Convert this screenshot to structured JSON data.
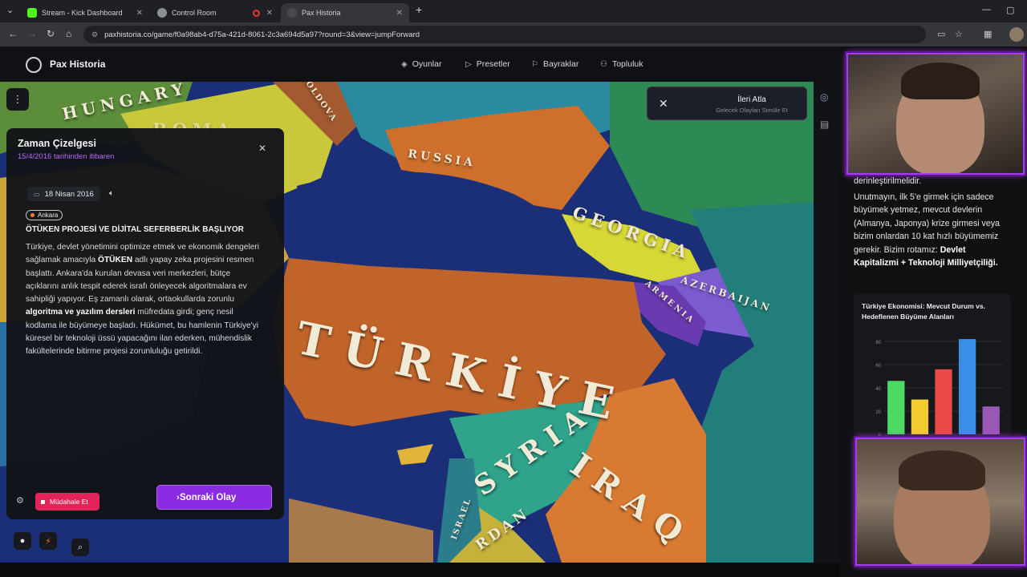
{
  "browser": {
    "tabs": [
      {
        "label": "Stream - Kick Dashboard",
        "icon": "kick-icon",
        "color": "#53fc18"
      },
      {
        "label": "Control Room",
        "icon": "globe-icon",
        "color": "#9aa0a6"
      },
      {
        "label": "Pax Historia",
        "icon": "pax-icon",
        "color": "#3a3b3f",
        "active": true
      }
    ],
    "url": "paxhistoria.co/game/f0a98ab4-d75a-421d-8061-2c3a694d5a97?round=3&view=jumpForward"
  },
  "app": {
    "brand": "Pax Historia",
    "menu": [
      {
        "label": "Oyunlar",
        "icon": "gamepad-icon"
      },
      {
        "label": "Presetler",
        "icon": "play-icon"
      },
      {
        "label": "Bayraklar",
        "icon": "flag-icon"
      },
      {
        "label": "Topluluk",
        "icon": "users-icon"
      }
    ]
  },
  "map": {
    "labels": {
      "hungary": "HUNGARY",
      "romania": "ROMA",
      "moldova": "MOLDOVA",
      "russia": "RUSSIA",
      "georgia": "GEORGIA",
      "armenia": "ARMENIA",
      "azerbaijan": "AZERBAIJAN",
      "turkiye": "TÜRKİYE",
      "syria": "SYRIA",
      "iraq": "IRAQ",
      "jordan": "RDAN",
      "israel": "ISRAEL"
    },
    "colors": {
      "sea": "#1b2f79",
      "turkiye": "#c1642a",
      "russia": "#cf6f2c",
      "georgia": "#d7d737",
      "azerbaijan": "#7b5bd0",
      "armenia": "#6a3ab0",
      "syria": "#2fa38b",
      "iraq": "#d87a32",
      "teal": "#227e7a"
    }
  },
  "skip": {
    "title": "İleri Atla",
    "subtitle": "Gelecek Olayları Simüle Et"
  },
  "timeline": {
    "title": "Zaman Çizelgesi",
    "subtitle": "15/4/2016 tarihinden itibaren",
    "date": "18 Nisan 2016",
    "location": "Ankara",
    "headline": "ÖTÜKEN PROJESİ VE DİJİTAL SEFERBERLİK BAŞLIYOR",
    "body": {
      "p1": "Türkiye, devlet yönetimini optimize etmek ve ekonomik dengeleri sağlamak amacıyla ",
      "b1": "ÖTÜKEN",
      "p2": " adlı yapay zeka projesini resmen başlattı. Ankara'da kurulan devasa veri merkezleri, bütçe açıklarını anlık tespit ederek israfı önleyecek algoritmalara ev sahipliği yapıyor. Eş zamanlı olarak, ortaokullarda zorunlu ",
      "b2": "algoritma ve yazılım dersleri",
      "p3": " müfredata girdi; genç nesil kodlama ile büyümeye başladı. Hükümet, bu hamlenin Türkiye'yi küresel bir teknoloji üssü yapacağını ilan ederken, mühendislik fakültelerinde bitirme projesi zorunluluğu getirildi."
    },
    "intervene_label": "Müdahale Et",
    "next_label": "Sonraki Olay"
  },
  "sidebar": {
    "top_fragment": "derinleştirilmelidir.",
    "text1": "Unutmayın, ilk 5'e girmek için sadece büyümek yetmez, mevcut devlerin (Almanya, Japonya) krize girmesi veya bizim onlardan 10 kat hızlı büyümemiz gerekir. Bizim rotamız: ",
    "text_bold": "Devlet Kapitalizmi + Teknoloji Milliyetçiliği.",
    "chart_title": "Türkiye Ekonomisi: Mevcut Durum vs. Hedeflenen Büyüme Alanları"
  },
  "chart_data": {
    "type": "bar",
    "title": "Türkiye Ekonomisi: Mevcut Durum vs. Hedeflenen Büyüme Alanları",
    "categories": [
      "",
      "",
      "",
      "",
      ""
    ],
    "values": [
      46,
      30,
      56,
      82,
      24
    ],
    "colors": [
      "#4cd964",
      "#f2cc2e",
      "#e94a45",
      "#3b8ee8",
      "#9b59b6"
    ],
    "ylim": [
      0,
      80
    ],
    "yticks": [
      0,
      20,
      40,
      60,
      80
    ],
    "xlabel": "",
    "ylabel": "",
    "grid": true
  }
}
